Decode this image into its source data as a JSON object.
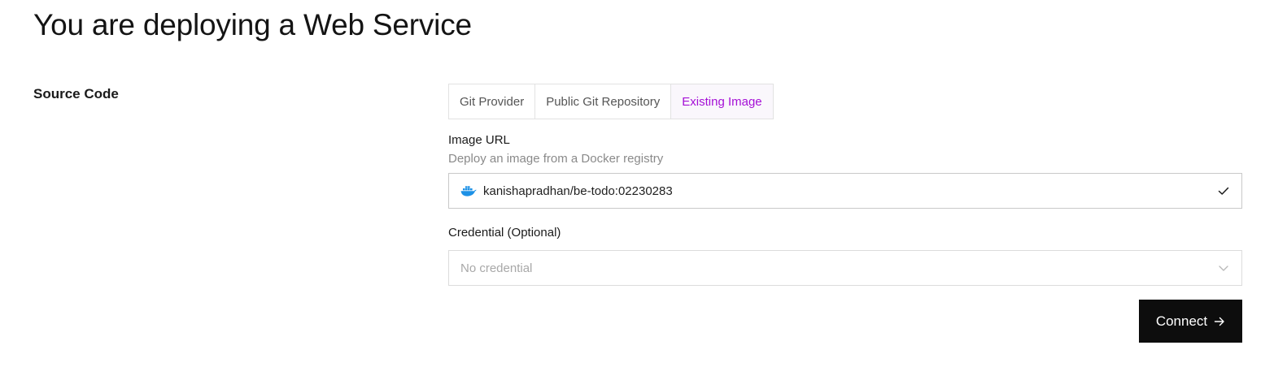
{
  "page": {
    "title": "You are deploying a Web Service"
  },
  "source_section": {
    "label": "Source Code",
    "tabs": [
      {
        "label": "Git Provider",
        "active": false
      },
      {
        "label": "Public Git Repository",
        "active": false
      },
      {
        "label": "Existing Image",
        "active": true
      }
    ],
    "image_url": {
      "label": "Image URL",
      "help": "Deploy an image from a Docker registry",
      "value": "kanishapradhan/be-todo:02230283",
      "icon": "docker-icon",
      "status_icon": "check-icon"
    },
    "credential": {
      "label": "Credential (Optional)",
      "placeholder": "No credential",
      "icon": "chevron-down-icon"
    },
    "connect_button": {
      "label": "Connect",
      "icon": "arrow-right-icon"
    }
  },
  "colors": {
    "accent": "#a510d6",
    "button_bg": "#0d0d0d",
    "docker_blue": "#1d91e6"
  }
}
